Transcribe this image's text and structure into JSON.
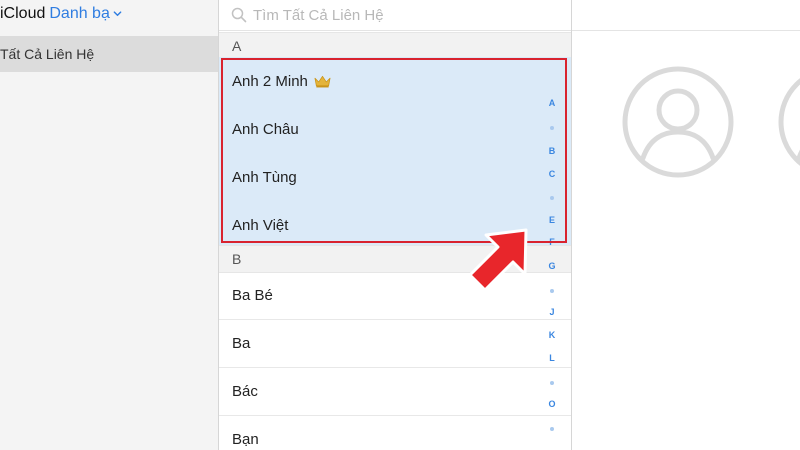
{
  "sidebar": {
    "brand_icloud": "iCloud",
    "brand_app": "Danh bạ",
    "group_label": "Tất Cả Liên Hệ"
  },
  "search": {
    "placeholder": "Tìm Tất Cả Liên Hệ"
  },
  "sections": [
    {
      "letter": "A",
      "contacts": [
        {
          "name": "Anh 2 Minh",
          "selected": true,
          "icon": "crown-icon"
        },
        {
          "name": "Anh Châu",
          "selected": true
        },
        {
          "name": "Anh Tùng",
          "selected": true
        },
        {
          "name": "Anh Việt",
          "selected": true
        }
      ]
    },
    {
      "letter": "B",
      "contacts": [
        {
          "name": "Ba Bé",
          "selected": false
        },
        {
          "name": "Ba",
          "selected": false
        },
        {
          "name": "Bác",
          "selected": false
        },
        {
          "name": "Bạn",
          "selected": false
        }
      ]
    }
  ],
  "index_letters": [
    "A",
    "B",
    "C",
    "E",
    "F",
    "G",
    "J",
    "K",
    "L",
    "O"
  ],
  "colors": {
    "accent": "#2f7de1",
    "selection": "#dbeaf8",
    "highlight_box": "#d9232f",
    "arrow": "#e8262b"
  },
  "icons": {
    "brand_chevron": "chevron-down-icon",
    "search": "search-icon",
    "crown": "crown-icon",
    "avatar": "avatar-placeholder-icon",
    "arrow": "pointer-arrow-icon"
  }
}
